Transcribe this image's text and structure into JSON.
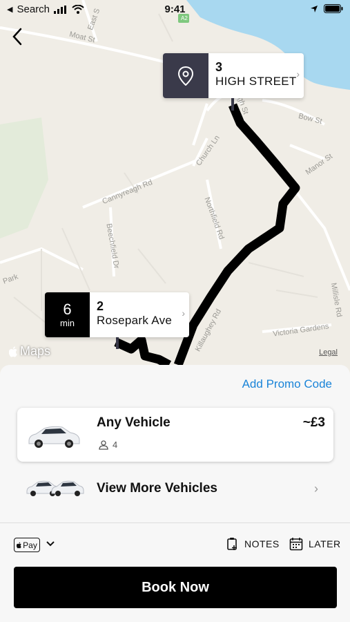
{
  "status_bar": {
    "back_app": "Search",
    "time": "9:41"
  },
  "map": {
    "labels": [
      "Moat St",
      "East S",
      "Bow St",
      "Church Ln",
      "Manor St",
      "Cannyreagh Rd",
      "Northfield Rd",
      "Beechfield Dr",
      "Millisle Rd",
      "Killaughey Rd",
      "Victoria Gardens",
      "Park",
      "High St"
    ],
    "brand": "Maps",
    "legal": "Legal",
    "road_badge": "A2"
  },
  "destination": {
    "number": "3",
    "street": "HIGH STREET",
    "icon": "location-pin-icon",
    "accent": "#3a3a4a"
  },
  "pickup": {
    "eta_value": "6",
    "eta_unit": "min",
    "number": "2",
    "street": "Rosepark Ave"
  },
  "sheet": {
    "promo_label": "Add Promo Code",
    "vehicle": {
      "title": "Any Vehicle",
      "seats": "4",
      "price": "~£3"
    },
    "more_vehicles_label": "View More Vehicles",
    "payment_method": "Pay",
    "notes_label": "NOTES",
    "later_label": "LATER",
    "book_label": "Book Now"
  },
  "colors": {
    "promo": "#1a84d8",
    "route": "#000000",
    "water": "#a8d8f0"
  }
}
